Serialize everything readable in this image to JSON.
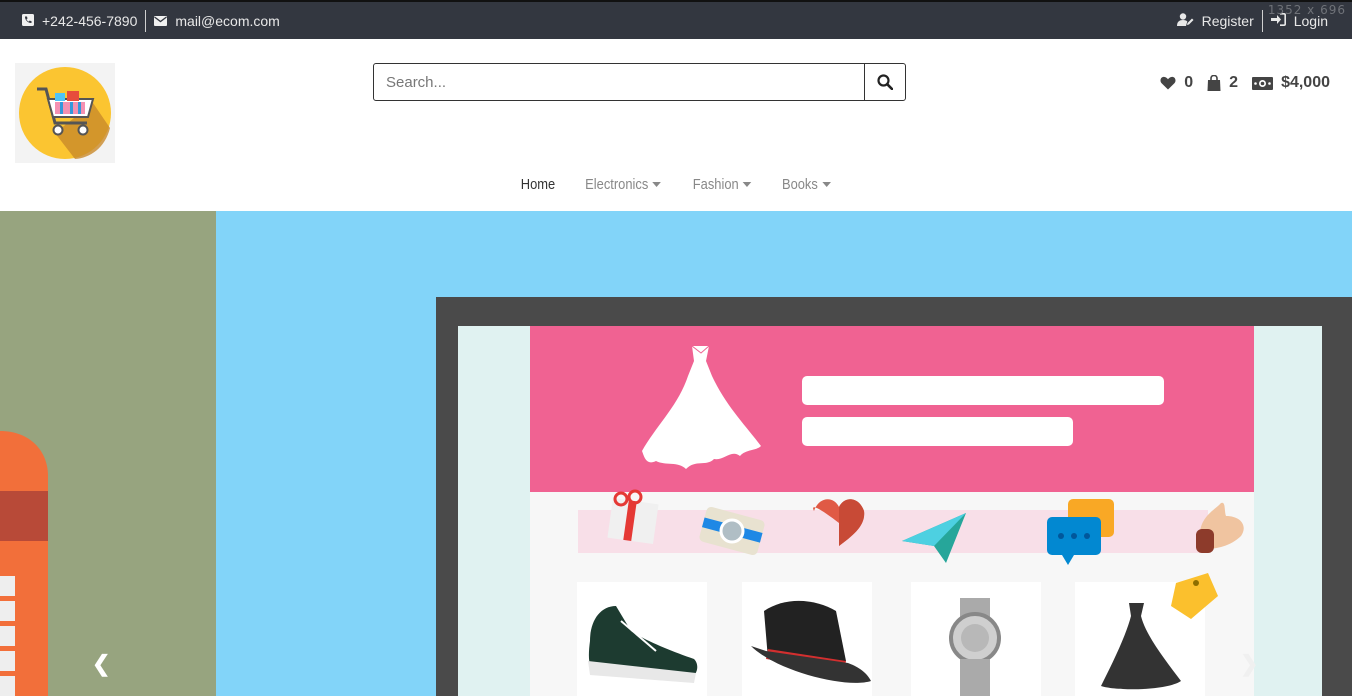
{
  "topbar": {
    "phone": "+242-456-7890",
    "email": "mail@ecom.com",
    "register_label": "Register",
    "login_label": "Login",
    "dims_label": "1352 x 696"
  },
  "header": {
    "search_placeholder": "Search...",
    "wishlist_count": "0",
    "cart_count": "2",
    "balance": "$4,000"
  },
  "nav": {
    "items": [
      {
        "label": "Home"
      },
      {
        "label": "Electronics"
      },
      {
        "label": "Fashion"
      },
      {
        "label": "Books"
      }
    ]
  },
  "colors": {
    "topbar_bg": "#333740",
    "hero_bg": "#82d4f9",
    "hero_left_bg": "#97a47f",
    "banner_pink": "#f06292"
  }
}
